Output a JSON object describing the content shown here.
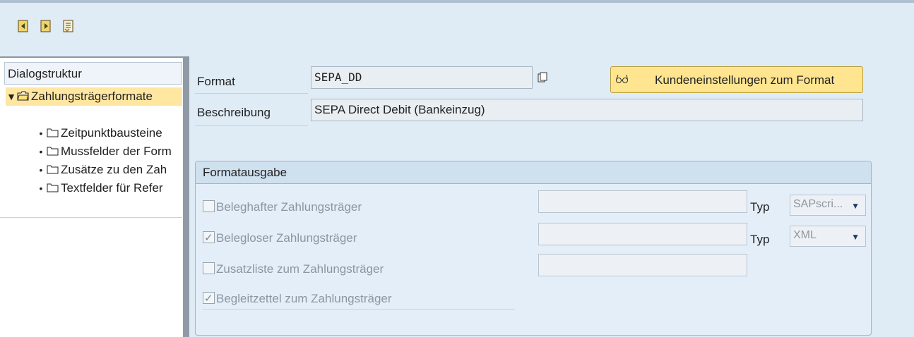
{
  "toolbar": {
    "buttons": [
      {
        "name": "previous-entry-button",
        "icon": "previous-entry-icon"
      },
      {
        "name": "next-entry-button",
        "icon": "next-entry-icon"
      },
      {
        "name": "variable-list-button",
        "icon": "variable-list-icon"
      }
    ]
  },
  "tree": {
    "header": "Dialogstruktur",
    "root": "Zahlungsträgerformate",
    "children": [
      "Zeitpunktbausteine",
      "Mussfelder der Form",
      "Zusätze zu den Zah",
      "Textfelder für Refer"
    ]
  },
  "form": {
    "format_label": "Format",
    "format_value": "SEPA_DD",
    "beschreibung_label": "Beschreibung",
    "beschreibung_value": "SEPA Direct Debit (Bankeinzug)",
    "action_button": "Kundeneinstellungen zum Format"
  },
  "formatausgabe": {
    "title": "Formatausgabe",
    "rows": [
      {
        "label": "Beleghafter Zahlungsträger",
        "checked": false,
        "typ_label": "Typ",
        "typ_value": "SAPscri..."
      },
      {
        "label": "Belegloser Zahlungsträger",
        "checked": true,
        "typ_label": "Typ",
        "typ_value": "XML"
      },
      {
        "label": "Zusatzliste zum Zahlungsträger",
        "checked": false
      },
      {
        "label": "Begleitzettel zum Zahlungsträger",
        "checked": true
      }
    ]
  },
  "colors": {
    "background": "#dfebf5",
    "selection": "#ffe7a1",
    "button": "#ffe590"
  }
}
